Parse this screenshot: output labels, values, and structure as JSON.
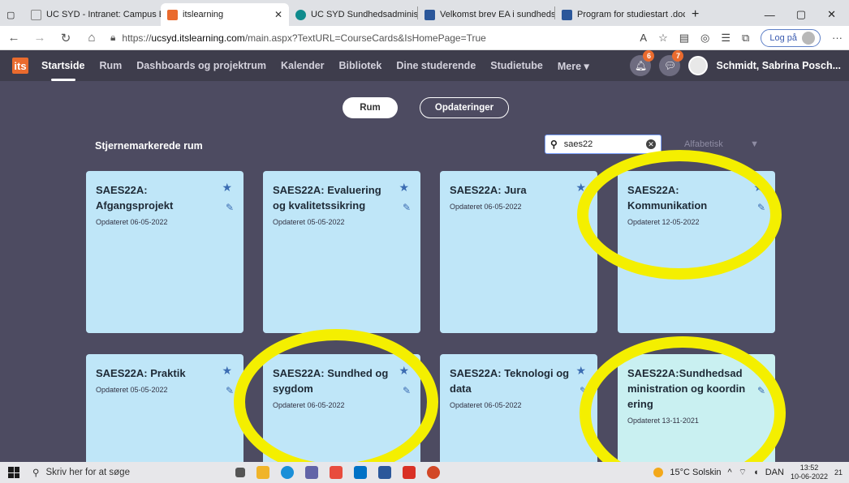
{
  "browser": {
    "tabs": [
      {
        "label": "UC SYD - Intranet: Campus Esbj",
        "color": "#ffffff"
      },
      {
        "label": "itslearning",
        "color": "#ea6b2e",
        "active": true
      },
      {
        "label": "UC SYD Sundhedsadministrativ k",
        "color": "#0f8b8d"
      },
      {
        "label": "Velkomst brev EA i sundhedsadm",
        "color": "#2b579a"
      },
      {
        "label": "Program for studiestart .docx",
        "color": "#2b579a"
      }
    ],
    "new_tab": "+",
    "url_prefix": "https://",
    "url_host": "ucsyd.itslearning.com",
    "url_path": "/main.aspx?TextURL=CourseCards&IsHomePage=True",
    "login_label": "Log på"
  },
  "nav": {
    "logo": "its",
    "items": [
      "Startside",
      "Rum",
      "Dashboards og projektrum",
      "Kalender",
      "Bibliotek",
      "Dine studerende",
      "Studietube",
      "Mere ▾"
    ],
    "notif_count": "6",
    "msg_count": "7",
    "user_name": "Schmidt, Sabrina Posch..."
  },
  "main": {
    "toggle_rum": "Rum",
    "toggle_updates": "Opdateringer",
    "section_title": "Stjernemarkerede rum",
    "search_value": "saes22",
    "sort_label": "Alfabetisk",
    "sort_arrow": "▼"
  },
  "cards": [
    {
      "title": "SAES22A: Afgangsprojekt",
      "date": "Opdateret 06-05-2022"
    },
    {
      "title": "SAES22A: Evaluering og kvalitetssikring",
      "date": "Opdateret 05-05-2022"
    },
    {
      "title": "SAES22A: Jura",
      "date": "Opdateret 06-05-2022"
    },
    {
      "title": "SAES22A: Kommunikation",
      "date": "Opdateret 12-05-2022"
    },
    {
      "title": "SAES22A: Praktik",
      "date": "Opdateret 05-05-2022"
    },
    {
      "title": "SAES22A: Sundhed og sygdom",
      "date": "Opdateret 06-05-2022"
    },
    {
      "title": "SAES22A: Teknologi og data",
      "date": "Opdateret 06-05-2022"
    },
    {
      "title": "SAES22A:Sundhedsadministration og koordinering",
      "date": "Opdateret 13-11-2021"
    }
  ],
  "taskbar": {
    "search_placeholder": "Skriv her for at søge",
    "weather": "15°C Solskin",
    "lang": "DAN",
    "time": "13:52",
    "date": "10-06-2022",
    "notif": "21"
  }
}
